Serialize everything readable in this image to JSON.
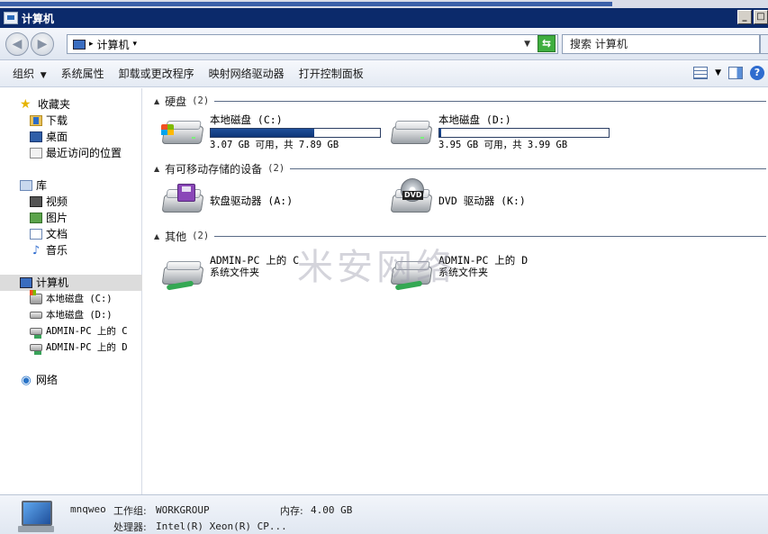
{
  "window": {
    "title": "计算机"
  },
  "address": {
    "path": "计算机",
    "search_placeholder": "搜索 计算机"
  },
  "toolbar": {
    "items": [
      "组织",
      "系统属性",
      "卸载或更改程序",
      "映射网络驱动器",
      "打开控制面板"
    ]
  },
  "nav": {
    "favorites": "收藏夹",
    "downloads": "下载",
    "desktop": "桌面",
    "recent": "最近访问的位置",
    "libraries": "库",
    "videos": "视频",
    "pictures": "图片",
    "documents": "文档",
    "music": "音乐",
    "computer": "计算机",
    "drive_c": "本地磁盘 (C:)",
    "drive_d": "本地磁盘 (D:)",
    "net_c": "ADMIN-PC 上的 C",
    "net_d": "ADMIN-PC 上的 D",
    "network": "网络"
  },
  "groups": {
    "hdd": {
      "label": "硬盘",
      "count": "(2)"
    },
    "removable": {
      "label": "有可移动存储的设备",
      "count": "(2)"
    },
    "other": {
      "label": "其他",
      "count": "(2)"
    }
  },
  "drives": {
    "c": {
      "name": "本地磁盘 (C:)",
      "free_text": "3.07 GB 可用，共 7.89 GB",
      "used_fraction": 0.61
    },
    "d": {
      "name": "本地磁盘 (D:)",
      "free_text": "3.95 GB 可用，共 3.99 GB",
      "used_fraction": 0.01
    },
    "floppy": {
      "name": "软盘驱动器 (A:)"
    },
    "dvd": {
      "name": "DVD 驱动器 (K:)"
    },
    "net_c": {
      "name": "ADMIN-PC 上的 C",
      "type": "系统文件夹"
    },
    "net_d": {
      "name": "ADMIN-PC 上的 D",
      "type": "系统文件夹"
    }
  },
  "watermark": "米安网络",
  "details": {
    "computer_name": "mnqweo",
    "workgroup_label": "工作组:",
    "workgroup": "WORKGROUP",
    "memory_label": "内存:",
    "memory": "4.00 GB",
    "cpu_label": "处理器:",
    "cpu": "Intel(R) Xeon(R) CP..."
  },
  "icons": {
    "back": "back-arrow-icon",
    "forward": "forward-arrow-icon",
    "refresh": "refresh-icon",
    "views": "views-icon",
    "preview_pane": "preview-pane-icon",
    "help": "help-icon"
  }
}
